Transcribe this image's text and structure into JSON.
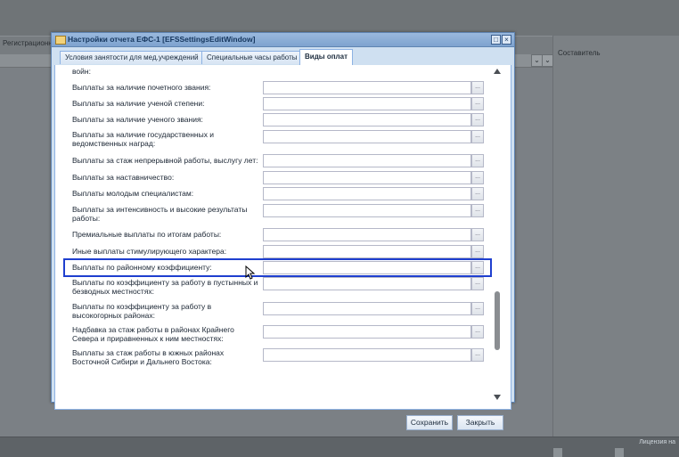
{
  "background": {
    "col_reg": "Регистрационн",
    "col_author": "Составитель",
    "license": "Лицензия на"
  },
  "window": {
    "title": "Настройки отчета ЕФС-1 [EFSSettingsEditWindow]",
    "tabs": [
      {
        "label": "Условия занятости для мед.учреждений",
        "active": false
      },
      {
        "label": "Специальные часы работы",
        "active": false
      },
      {
        "label": "Виды оплат",
        "active": true
      }
    ],
    "partial_top_label": "войн:",
    "rows": [
      {
        "label": "Выплаты за наличие почетного звания:",
        "value": ""
      },
      {
        "label": "Выплаты за наличие ученой степени:",
        "value": ""
      },
      {
        "label": "Выплаты за наличие ученого звания:",
        "value": ""
      },
      {
        "label": "Выплаты за наличие государственных и ведомственных наград:",
        "value": ""
      },
      {
        "label": "Выплаты за стаж непрерывной работы, выслугу лет:",
        "value": ""
      },
      {
        "label": "Выплаты за наставничество:",
        "value": ""
      },
      {
        "label": "Выплаты молодым специалистам:",
        "value": ""
      },
      {
        "label": "Выплаты за интенсивность и высокие результаты работы:",
        "value": ""
      },
      {
        "label": "Премиальные выплаты по итогам работы:",
        "value": ""
      },
      {
        "label": "Иные выплаты стимулирующего характера:",
        "value": ""
      },
      {
        "label": "Выплаты по районному коэффициенту:",
        "value": ""
      },
      {
        "label": "Выплаты по коэффициенту за работу в пустынных и безводных местностях:",
        "value": ""
      },
      {
        "label": "Выплаты по коэффициенту за работу в высокогорных районах:",
        "value": ""
      },
      {
        "label": "Надбавка за стаж работы в районах Крайнего Севера и приравненных к ним местностях:",
        "value": ""
      },
      {
        "label": "Выплаты за стаж работы в южных районах Восточной Сибири и Дальнего Востока:",
        "value": ""
      }
    ],
    "trigger_glyph": "...",
    "buttons": {
      "save": "Сохранить",
      "close": "Закрыть"
    }
  },
  "colors": {
    "highlight": "#1f3fcf",
    "title_text": "#15365e"
  }
}
